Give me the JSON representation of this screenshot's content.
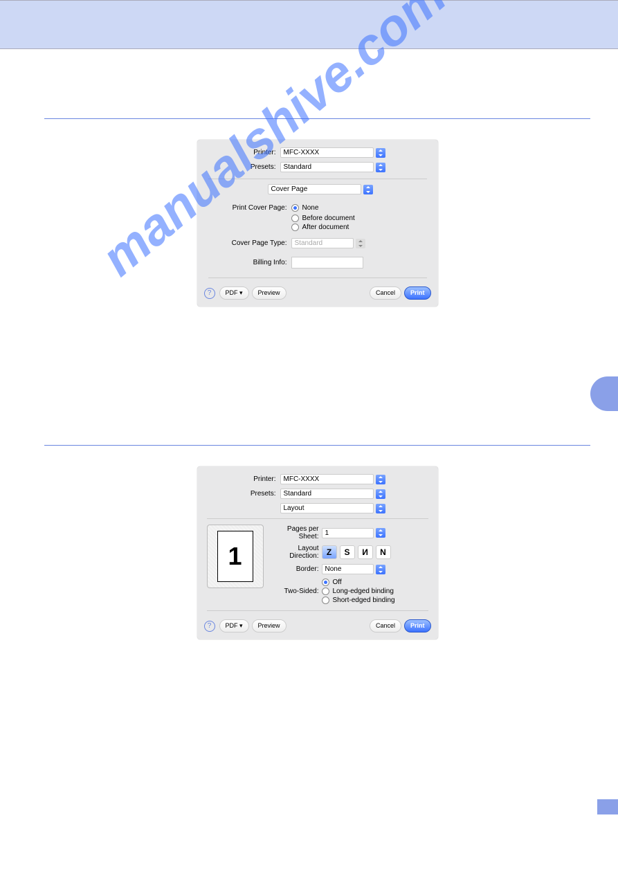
{
  "watermark": "manualshive.com",
  "cover": {
    "printer_label": "Printer:",
    "printer_value": "MFC-XXXX",
    "presets_label": "Presets:",
    "presets_value": "Standard",
    "section_value": "Cover Page",
    "pcp_label": "Print Cover Page:",
    "opt_none": "None",
    "opt_before": "Before document",
    "opt_after": "After document",
    "cpt_label": "Cover Page Type:",
    "cpt_value": "Standard",
    "billing_label": "Billing Info:",
    "help": "?",
    "pdf": "PDF ▾",
    "preview": "Preview",
    "cancel": "Cancel",
    "print": "Print"
  },
  "layout": {
    "printer_label": "Printer:",
    "printer_value": "MFC-XXXX",
    "presets_label": "Presets:",
    "presets_value": "Standard",
    "section_value": "Layout",
    "pps_label": "Pages per Sheet:",
    "pps_value": "1",
    "ld_label": "Layout Direction:",
    "border_label": "Border:",
    "border_value": "None",
    "ts_label": "Two-Sided:",
    "ts_off": "Off",
    "ts_long": "Long-edged binding",
    "ts_short": "Short-edged binding",
    "preview_page": "1",
    "help": "?",
    "pdf": "PDF ▾",
    "preview": "Preview",
    "cancel": "Cancel",
    "print": "Print"
  }
}
